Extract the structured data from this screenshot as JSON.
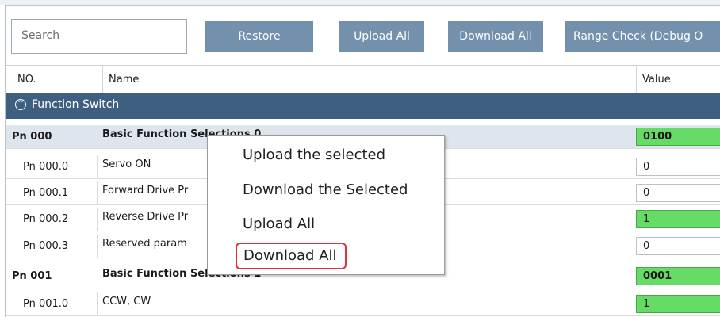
{
  "toolbar": {
    "search_placeholder": "Search",
    "restore_label": "Restore",
    "upload_all_label": "Upload All",
    "download_all_label": "Download All",
    "range_check_label": "Range Check (Debug O"
  },
  "table": {
    "headers": {
      "no": "NO.",
      "name": "Name",
      "value": "Value"
    },
    "group": {
      "label": "Function Switch",
      "icon": "chevron-up-circle-icon"
    },
    "rows": [
      {
        "no": "Pn 000",
        "name": "Basic Function Selections 0",
        "value": "0100",
        "value_color": "green"
      },
      {
        "no": "Pn 000.0",
        "name": "Servo ON",
        "value": "0",
        "value_color": "white"
      },
      {
        "no": "Pn 000.1",
        "name": "Forward Drive Pr",
        "value": "0",
        "value_color": "white"
      },
      {
        "no": "Pn 000.2",
        "name": "Reverse Drive Pr",
        "value": "1",
        "value_color": "green"
      },
      {
        "no": "Pn 000.3",
        "name": "Reserved param",
        "value": "0",
        "value_color": "white"
      },
      {
        "no": "Pn 001",
        "name": "Basic Function Selections 1",
        "value": "0001",
        "value_color": "green"
      },
      {
        "no": "Pn 001.0",
        "name": "CCW, CW",
        "value": "1",
        "value_color": "green"
      }
    ]
  },
  "context_menu": {
    "items": [
      {
        "label": "Upload the selected"
      },
      {
        "label": "Download the Selected"
      },
      {
        "label": "Upload All"
      },
      {
        "label": "Download All",
        "highlighted": true
      }
    ]
  },
  "colors": {
    "header_blue": "#3f5f80",
    "button_blue": "#7390ad",
    "value_green": "#66dc66",
    "highlight_red": "#e0323a"
  }
}
